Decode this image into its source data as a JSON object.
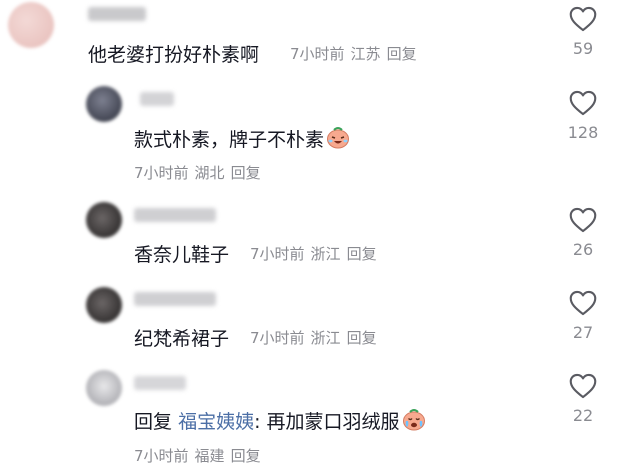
{
  "comments": [
    {
      "text": "他老婆打扮好朴素啊",
      "time": "7小时前",
      "location": "江苏",
      "reply_label": "回复",
      "likes": "59"
    },
    {
      "text": "款式朴素，牌子不朴素",
      "emoji": "crying-laughing-emoji",
      "time": "7小时前",
      "location": "湖北",
      "reply_label": "回复",
      "likes": "128"
    },
    {
      "text": "香奈儿鞋子",
      "time": "7小时前",
      "location": "浙江",
      "reply_label": "回复",
      "likes": "26"
    },
    {
      "text": "纪梵希裙子",
      "time": "7小时前",
      "location": "浙江",
      "reply_label": "回复",
      "likes": "27"
    },
    {
      "reply_prefix": "回复",
      "mention": "福宝姨姨",
      "text": ": 再加蒙口羽绒服",
      "emoji": "crying-emoji",
      "time": "7小时前",
      "location": "福建",
      "reply_label": "回复",
      "likes": "22"
    }
  ]
}
